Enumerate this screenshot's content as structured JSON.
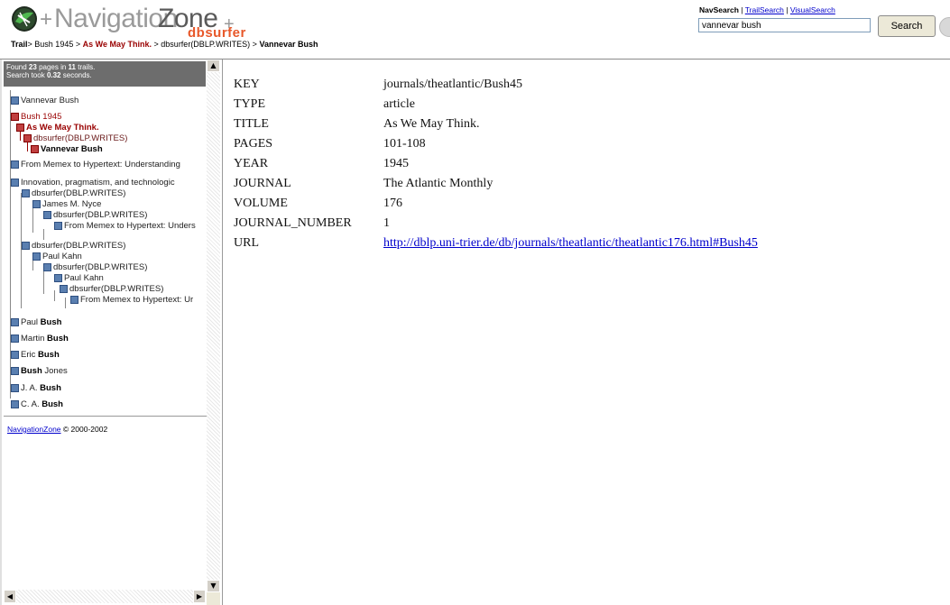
{
  "header": {
    "logo_plus_left": "+",
    "logo_nav": "Navigation",
    "logo_zone": "Zone",
    "logo_plus_right": "+",
    "logo_sub": "dbsurfer",
    "trail": {
      "lead": "Trail",
      "sep": ">",
      "items": [
        {
          "label": "Bush 1945",
          "style": "normal"
        },
        {
          "label": "As We May Think.",
          "style": "current"
        },
        {
          "label": "dbsurfer(DBLP.WRITES)",
          "style": "normal"
        },
        {
          "label": "Vannevar Bush",
          "style": "bold"
        }
      ]
    },
    "search_links": {
      "active": "NavSearch",
      "sep": "|",
      "trail_search": "TrailSearch",
      "visual_search": "VisualSearch"
    },
    "search_value": "vannevar bush",
    "search_button": "Search"
  },
  "sidebar": {
    "stats": {
      "found_prefix": "Found",
      "pages": "23",
      "pages_mid": "pages in",
      "trails": "11",
      "trails_suffix": "trails.",
      "search_prefix": "Search took",
      "seconds": "0.32",
      "seconds_suffix": "seconds."
    },
    "tree": {
      "root_node": "Vannevar Bush",
      "bush1945": "Bush 1945",
      "as_we_may_think": "As We May Think.",
      "dbsurfer1": "dbsurfer(DBLP.WRITES)",
      "vannevar_bold": "Vannevar Bush",
      "memex": "From Memex to Hypertext: Understanding",
      "innovation": "Innovation, pragmatism, and technologic",
      "dbsurfer2": "dbsurfer(DBLP.WRITES)",
      "nyce": "James M. Nyce",
      "dbsurfer3": "dbsurfer(DBLP.WRITES)",
      "memex2": "From Memex to Hypertext: Unders",
      "dbsurfer4": "dbsurfer(DBLP.WRITES)",
      "kahn1": "Paul Kahn",
      "dbsurfer5": "dbsurfer(DBLP.WRITES)",
      "kahn2": "Paul Kahn",
      "dbsurfer6": "dbsurfer(DBLP.WRITES)",
      "memex3": "From Memex to Hypertext: Ur",
      "paul_first": "Paul",
      "paul_last": "Bush",
      "martin_first": "Martin",
      "martin_last": "Bush",
      "eric_first": "Eric",
      "eric_last": "Bush",
      "bj_first": "Bush",
      "bj_last": "Jones",
      "ja_first": "J. A.",
      "ja_last": "Bush",
      "ca_first": "C. A.",
      "ca_last": "Bush"
    },
    "copyright_link": "NavigationZone",
    "copyright_text": "© 2000-2002"
  },
  "record": {
    "rows": [
      {
        "key": "KEY",
        "value": "journals/theatlantic/Bush45"
      },
      {
        "key": "TYPE",
        "value": "article"
      },
      {
        "key": "TITLE",
        "value": "As We May Think."
      },
      {
        "key": "PAGES",
        "value": "101-108"
      },
      {
        "key": "YEAR",
        "value": "1945"
      },
      {
        "key": "JOURNAL",
        "value": "The Atlantic Monthly"
      },
      {
        "key": "VOLUME",
        "value": "176"
      },
      {
        "key": "JOURNAL_NUMBER",
        "value": "1"
      }
    ],
    "url_key": "URL",
    "url_value": "http://dblp.uni-trier.de/db/journals/theatlantic/theatlantic176.html#Bush45"
  },
  "colors": {
    "trail_current": "#990000",
    "link": "#0000cc",
    "logo_accent": "#e8582a",
    "stats_bg": "#6d6d6d"
  },
  "icons": [
    "globe-logo-icon",
    "tree-node-icon",
    "scroll-up-arrow-icon",
    "scroll-down-arrow-icon",
    "scroll-left-arrow-icon",
    "scroll-right-arrow-icon"
  ]
}
